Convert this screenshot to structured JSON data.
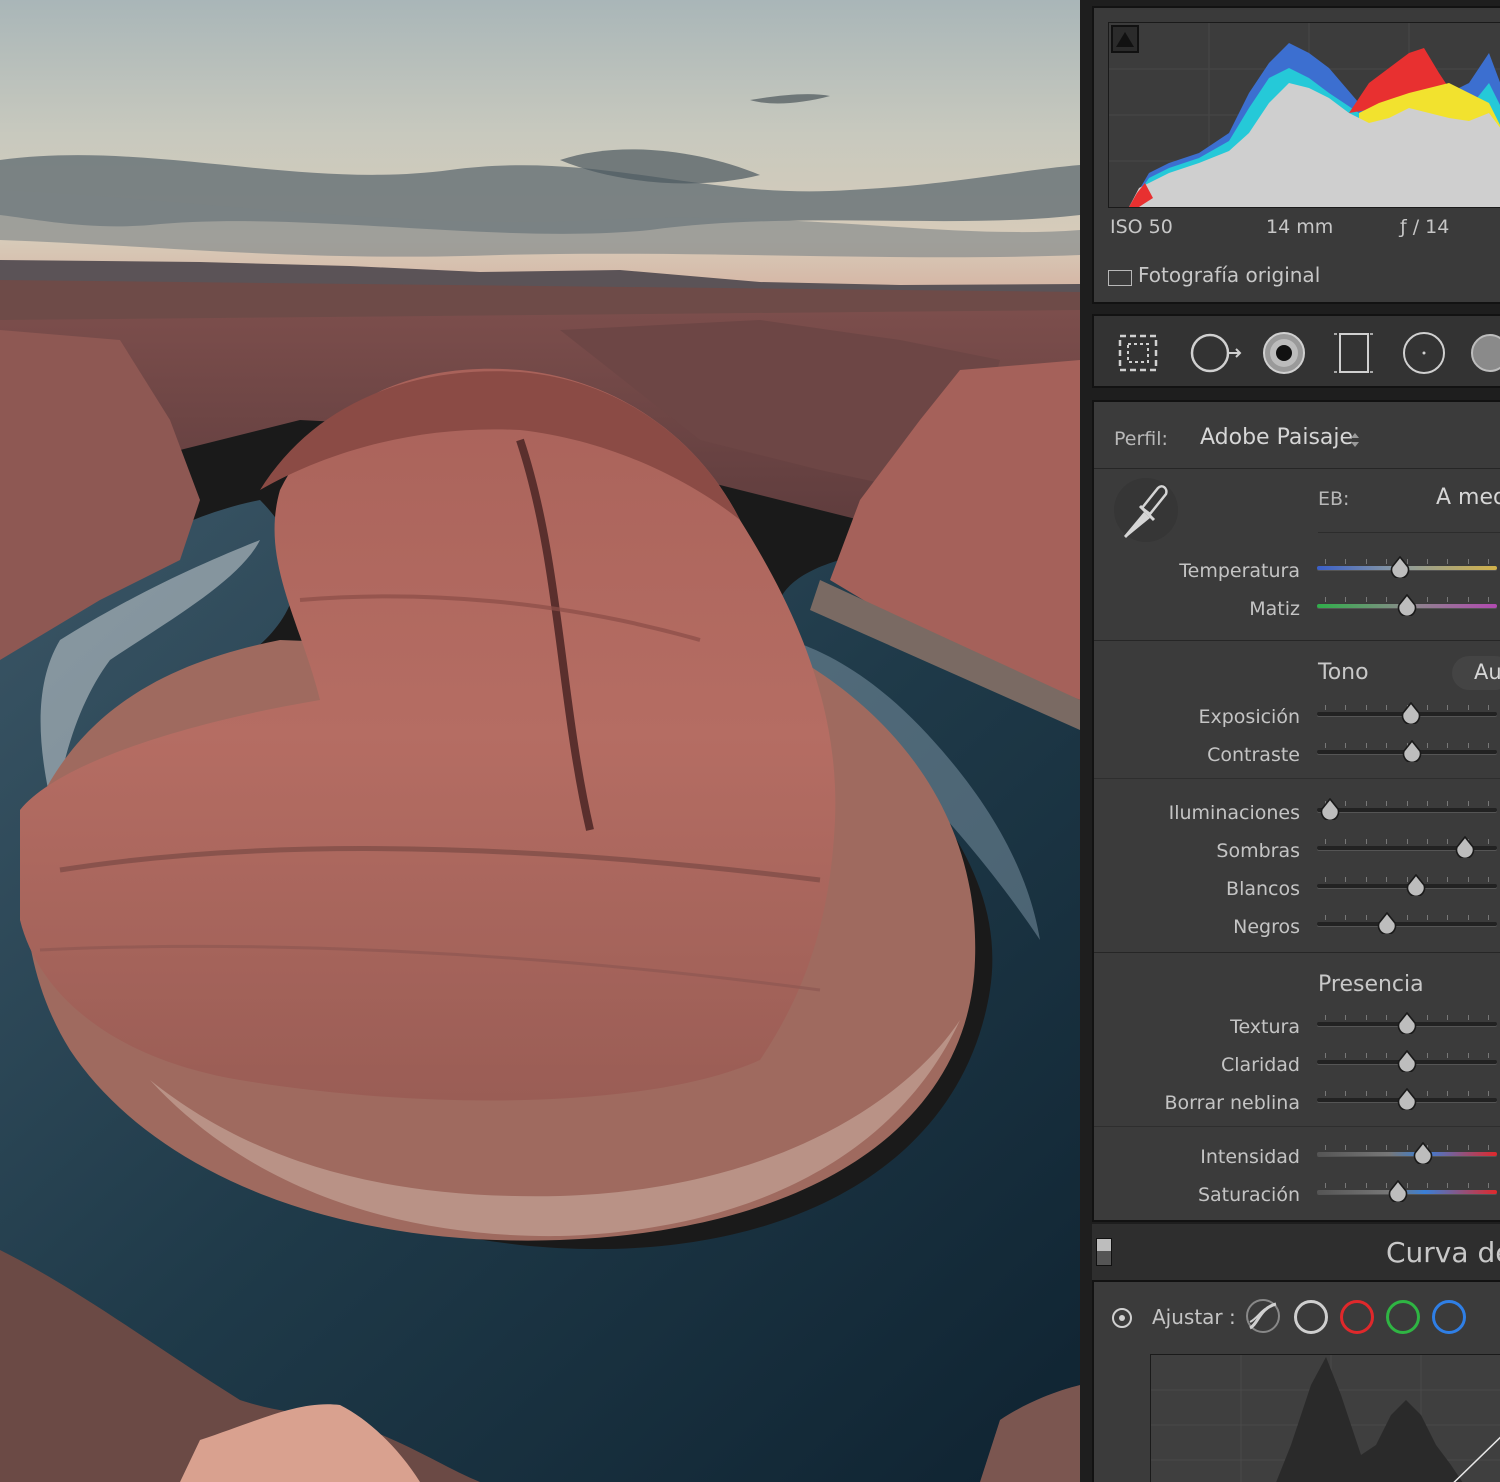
{
  "photo": {
    "alt_name": "horseshoe-bend-photo"
  },
  "histogram": {
    "iso": "ISO 50",
    "focal": "14 mm",
    "aperture": "ƒ / 14",
    "original_label": "Fotografía original"
  },
  "tools": [
    "crop-tool-icon",
    "spot-removal-icon",
    "red-eye-icon",
    "linear-gradient-icon",
    "radial-gradient-icon",
    "brush-icon"
  ],
  "basic": {
    "profile_label": "Perfil:",
    "profile_value": "Adobe Paisaje",
    "wb_label": "EB:",
    "wb_value": "A med",
    "sliders_wb": [
      {
        "label": "Temperatura",
        "value": 0.46,
        "track": "temp"
      },
      {
        "label": "Matiz",
        "value": 0.5,
        "track": "tint"
      }
    ],
    "tone_title": "Tono",
    "auto_label": "Au",
    "sliders_tone": [
      {
        "label": "Exposición",
        "value": 0.52
      },
      {
        "label": "Contraste",
        "value": 0.53
      }
    ],
    "sliders_tone2": [
      {
        "label": "Iluminaciones",
        "value": 0.07
      },
      {
        "label": "Sombras",
        "value": 0.82
      },
      {
        "label": "Blancos",
        "value": 0.55
      },
      {
        "label": "Negros",
        "value": 0.39
      }
    ],
    "presence_title": "Presencia",
    "sliders_presence": [
      {
        "label": "Textura",
        "value": 0.5
      },
      {
        "label": "Claridad",
        "value": 0.5
      },
      {
        "label": "Borrar neblina",
        "value": 0.5
      }
    ],
    "sliders_presence2": [
      {
        "label": "Intensidad",
        "value": 0.59,
        "track": "color"
      },
      {
        "label": "Saturación",
        "value": 0.45,
        "track": "color"
      }
    ]
  },
  "curve": {
    "title": "Curva de",
    "adjust_label": "Ajustar :",
    "channels": [
      "parametric-icon",
      "point-curve-white",
      "red-channel",
      "green-channel",
      "blue-channel"
    ],
    "colors": {
      "white": "#cfcfcf",
      "red": "#e0282b",
      "green": "#2fb543",
      "blue": "#2f7fe6"
    }
  }
}
